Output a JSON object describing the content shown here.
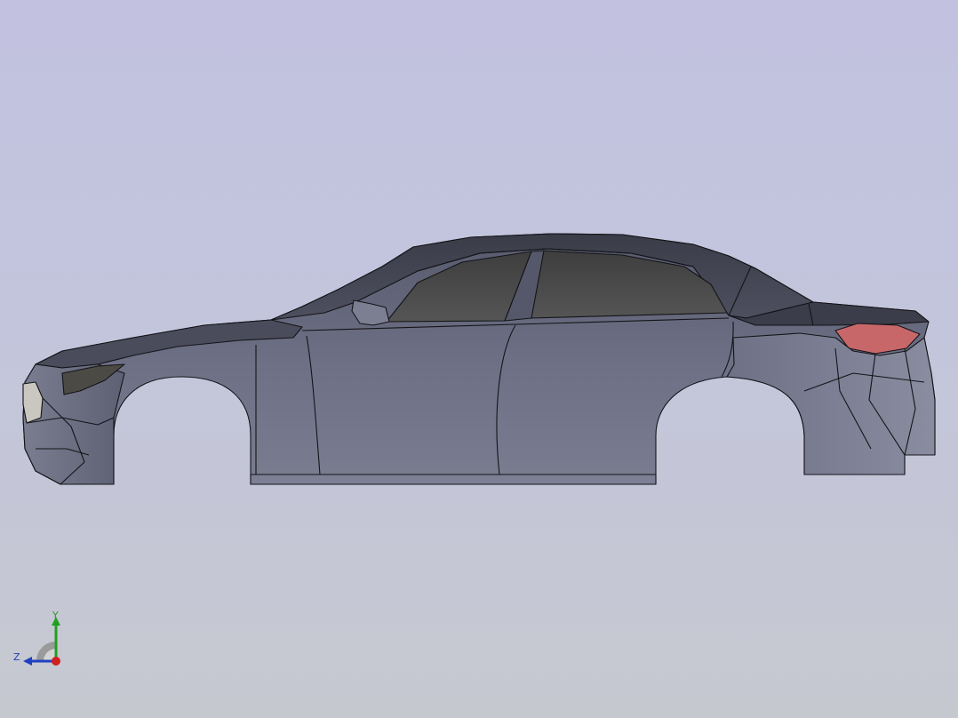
{
  "viewport": {
    "background_top": "#c2c2e0",
    "background_bottom": "#c6c8d0"
  },
  "model": {
    "body_color": "#6b6e82",
    "glass_color": "#4a4a4a",
    "taillight_color": "#c8676a",
    "outline_color": "#141418"
  },
  "triad": {
    "y_label": "Y",
    "z_label": "Z",
    "y_color": "#20a020",
    "z_color": "#2040c0",
    "x_color": "#d02020"
  }
}
